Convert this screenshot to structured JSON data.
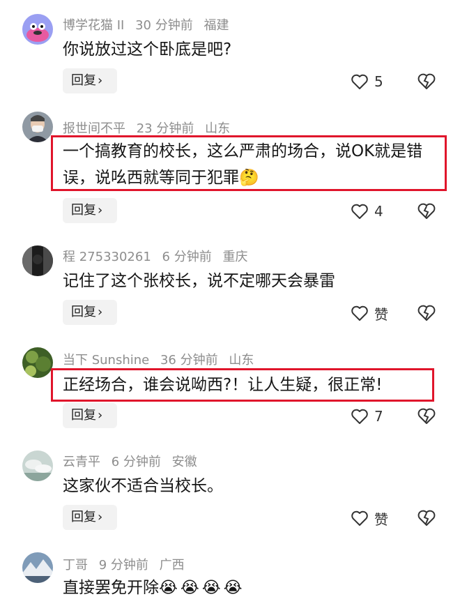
{
  "comments": [
    {
      "username": "博学花猫 II",
      "time": "30 分钟前",
      "location": "福建",
      "text": "你说放过这个卧底是吧?",
      "emoji": "",
      "reply_label": "回复",
      "likes": "5",
      "avatar_colors": {
        "bg": "#9a9ff2",
        "fg": "#e85aa0"
      }
    },
    {
      "username": "报世间不平",
      "time": "23 分钟前",
      "location": "山东",
      "text": "一个搞教育的校长，这么严肃的场合，说OK就是错误，说吆西就等同于犯罪",
      "emoji": "🤔",
      "reply_label": "回复",
      "likes": "4",
      "highlighted": true,
      "avatar_colors": {
        "bg": "#6b7782",
        "fg": "#e8e2dc"
      }
    },
    {
      "username": "程 275330261",
      "time": "6 分钟前",
      "location": "重庆",
      "text": "记住了这个张校长，说不定哪天会暴雷",
      "emoji": "",
      "reply_label": "回复",
      "likes": "赞",
      "avatar_colors": {
        "bg": "#202020",
        "fg": "#555555"
      }
    },
    {
      "username": "当下 Sunshine",
      "time": "36 分钟前",
      "location": "山东",
      "text": "正经场合，谁会说呦西?！让人生疑，很正常!",
      "emoji": "",
      "reply_label": "回复",
      "likes": "7",
      "highlighted": true,
      "avatar_colors": {
        "bg": "#4d6e2e",
        "fg": "#9cbc5a"
      }
    },
    {
      "username": "云青平",
      "time": "6 分钟前",
      "location": "安徽",
      "text": "这家伙不适合当校长。",
      "emoji": "",
      "reply_label": "回复",
      "likes": "赞",
      "avatar_colors": {
        "bg": "#b9c9c4",
        "fg": "#e8ecea"
      }
    },
    {
      "username": "丁哥",
      "time": "9 分钟前",
      "location": "广西",
      "text": "直接罢免开除",
      "emoji": "😭😭😭😭",
      "reply_label": "",
      "likes": "",
      "avatar_colors": {
        "bg": "#6d8aa8",
        "fg": "#e5e9ee"
      }
    }
  ],
  "colors": {
    "highlight": "#e0152b",
    "meta": "#8d8d8d"
  },
  "icons": {
    "like": "heart-outline-icon",
    "dislike": "broken-heart-icon",
    "reply_chevron": "chevron-right-icon"
  }
}
